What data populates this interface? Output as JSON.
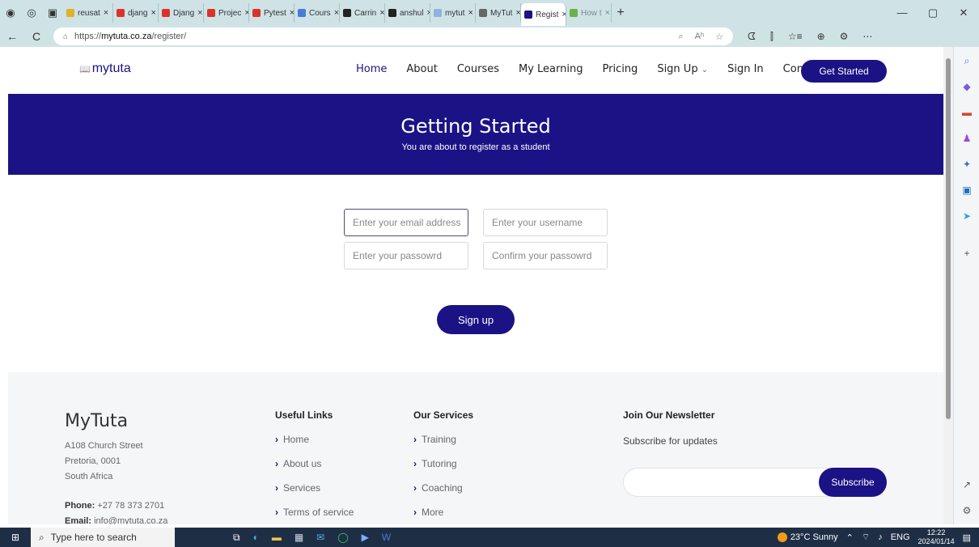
{
  "browser": {
    "tabs": [
      {
        "label": "reusat",
        "color": "#e1b12c"
      },
      {
        "label": "djang",
        "color": "#d9342b"
      },
      {
        "label": "Djang",
        "color": "#d9342b"
      },
      {
        "label": "Projec",
        "color": "#d9342b"
      },
      {
        "label": "Pytest",
        "color": "#d9342b"
      },
      {
        "label": "Cours",
        "color": "#4a7bd6"
      },
      {
        "label": "Carrin",
        "color": "#222222"
      },
      {
        "label": "anshul",
        "color": "#222222"
      },
      {
        "label": "mytut",
        "color": "#8fb3e0"
      },
      {
        "label": "MyTut",
        "color": "#666666"
      },
      {
        "label": "Regist",
        "color": "#1b1385"
      },
      {
        "label": "How t",
        "color": "#6ab04c"
      }
    ],
    "close_glyph": "×",
    "url_prefix": "https://",
    "url_host": "mytuta.co.za",
    "url_path": "/register/",
    "glyphs": {
      "back": "←",
      "refresh": "C",
      "lock": "⌂",
      "new_tab": "+",
      "minimize": "—",
      "restore": "▢",
      "close": "✕",
      "read_aloud": "Aʰ",
      "favorite": "☆",
      "tools": [
        "ᗧ",
        "⫿",
        "☆≡",
        "⊕",
        "⚙",
        "⋯"
      ],
      "url_icons": [
        "⌕",
        "Aʰ",
        "☆"
      ]
    }
  },
  "site": {
    "logo_text": "mytuta",
    "nav": [
      "Home",
      "About",
      "Courses",
      "My Learning",
      "Pricing",
      "Sign Up",
      "Sign In",
      "Contact"
    ],
    "signup_chevron": "⌄",
    "cta": "Get Started"
  },
  "hero": {
    "title": "Getting Started",
    "subtitle": "You are about to register as a student"
  },
  "form": {
    "email_placeholder": "Enter your email address",
    "username_placeholder": "Enter your username",
    "password_placeholder": "Enter your passowrd",
    "confirm_placeholder": "Confirm your passowrd",
    "submit": "Sign up"
  },
  "footer": {
    "brand": "MyTuta",
    "address": [
      "A108 Church Street",
      "Pretoria, 0001",
      "South Africa"
    ],
    "phone_label": "Phone:",
    "phone": "+27 78 373 2701",
    "email_label": "Email:",
    "email": "info@mytuta.co.za",
    "useful_links_title": "Useful Links",
    "useful_links": [
      "Home",
      "About us",
      "Services",
      "Terms of service"
    ],
    "services_title": "Our Services",
    "services": [
      "Training",
      "Tutoring",
      "Coaching",
      "More"
    ],
    "newsletter_title": "Join Our Newsletter",
    "newsletter_text": "Subscribe for updates",
    "subscribe": "Subscribe",
    "chevron": "›"
  },
  "taskbar": {
    "search_placeholder": "Type here to search",
    "weather": "23°C  Sunny",
    "language": "ENG",
    "time": "12:22",
    "date": "2024/01/14"
  },
  "colors": {
    "brand": "#1b1385",
    "chrome": "#cfe3e6",
    "taskbar": "#1e2f45"
  }
}
